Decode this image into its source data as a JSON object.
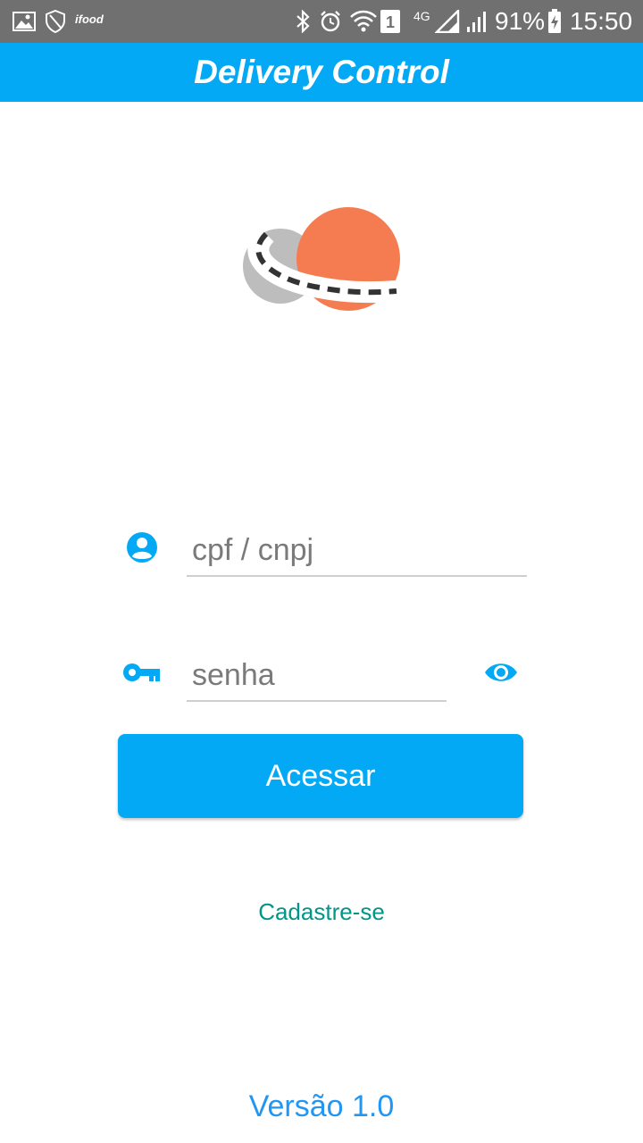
{
  "status_bar": {
    "notification_icons": [
      "image-icon",
      "shield-icon",
      "ifood-icon"
    ],
    "ifood_label": "ifood",
    "sim_slot": "1",
    "network": "4G",
    "battery": "91%",
    "time": "15:50"
  },
  "app_bar": {
    "title": "Delivery Control"
  },
  "login": {
    "cpf_placeholder": "cpf / cnpj",
    "cpf_value": "",
    "password_placeholder": "senha",
    "password_value": "",
    "submit_label": "Acessar",
    "register_label": "Cadastre-se"
  },
  "footer": {
    "version": "Versão 1.0"
  },
  "colors": {
    "primary": "#03A9F4",
    "status_bar": "#707070",
    "link": "#009688",
    "version": "#2196F3",
    "logo_orange": "#F47C50",
    "logo_gray": "#BDBDBD"
  }
}
